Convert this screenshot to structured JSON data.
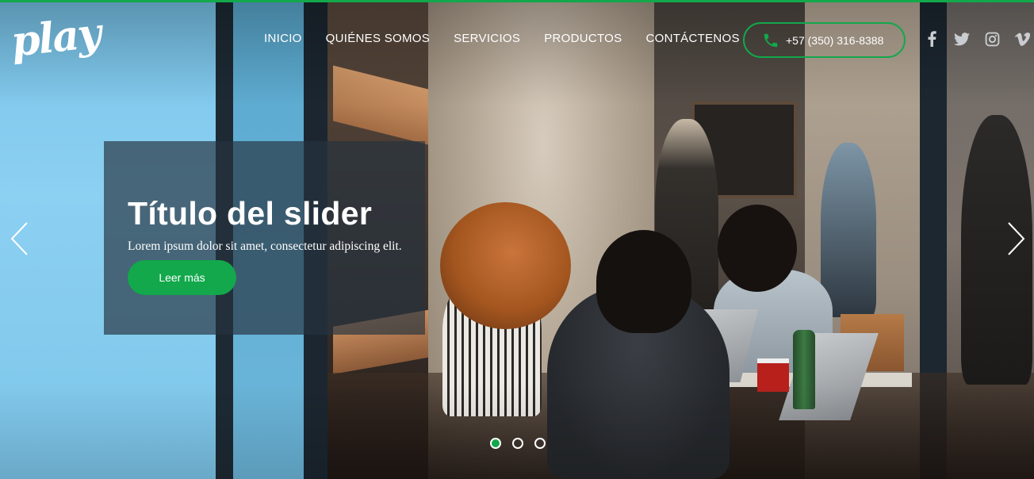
{
  "brand": {
    "logo_text": "play"
  },
  "nav": {
    "items": [
      {
        "label": "INICIO"
      },
      {
        "label": "QUIÉNES SOMOS"
      },
      {
        "label": "SERVICIOS"
      },
      {
        "label": "PRODUCTOS"
      },
      {
        "label": "CONTÁCTENOS"
      }
    ]
  },
  "contact": {
    "phone": "+57 (350) 316-8388",
    "icon": "phone-icon"
  },
  "social": {
    "icons": [
      "facebook-icon",
      "twitter-icon",
      "instagram-icon",
      "vimeo-icon"
    ]
  },
  "slider": {
    "title": "Título del slider",
    "text": "Lorem ipsum dolor sit amet, consectetur adipiscing elit.",
    "button_label": "Leer más",
    "slide_count": 3,
    "active_slide": 1
  },
  "colors": {
    "accent": "#12a84b",
    "caption_bg": "#26343f",
    "text": "#ffffff"
  }
}
